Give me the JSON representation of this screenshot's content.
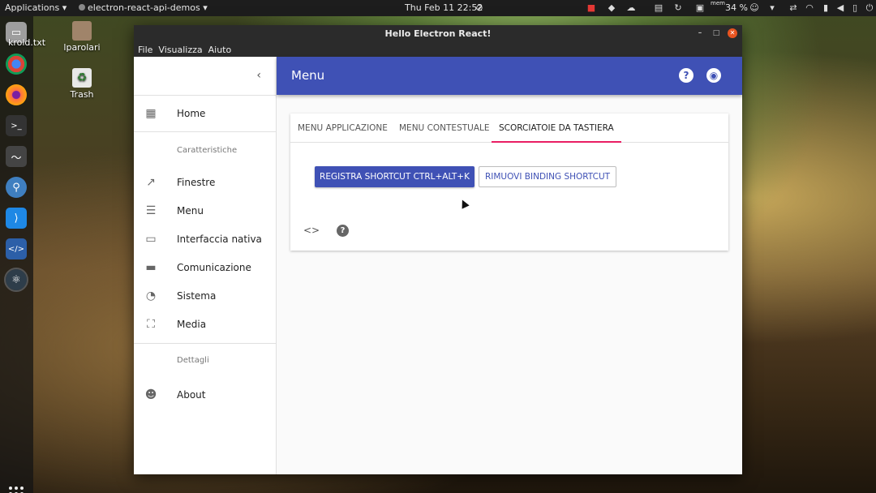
{
  "topbar": {
    "applications": "Applications ▾",
    "active_app": "electron-react-api-demos ▾",
    "clock": "Thu Feb 11  22:52",
    "mem_label": "mem",
    "mem_percent": "34 %"
  },
  "desktop": {
    "icons": [
      {
        "label": "krold.txt"
      },
      {
        "label": "lparolari"
      },
      {
        "label": "Trash"
      }
    ]
  },
  "window": {
    "title": "Hello Electron React!",
    "menu": [
      "File",
      "Visualizza",
      "Aiuto"
    ]
  },
  "sidebar": {
    "items": [
      {
        "label": "Home",
        "icon": "dashboard-icon"
      },
      {
        "section": "Caratteristiche"
      },
      {
        "label": "Finestre",
        "icon": "open-in-new-icon"
      },
      {
        "label": "Menu",
        "icon": "list-icon"
      },
      {
        "label": "Interfaccia nativa",
        "icon": "airplay-icon"
      },
      {
        "label": "Comunicazione",
        "icon": "chat-icon"
      },
      {
        "label": "Sistema",
        "icon": "speedometer-icon"
      },
      {
        "label": "Media",
        "icon": "photo-size-select-icon"
      },
      {
        "section": "Dettagli"
      },
      {
        "label": "About",
        "icon": "people-icon"
      }
    ]
  },
  "appbar": {
    "title": "Menu"
  },
  "tabs": [
    {
      "label": "MENU APPLICAZIONE"
    },
    {
      "label": "MENU CONTESTUALE"
    },
    {
      "label": "SCORCIATOIE DA TASTIERA",
      "active": true
    }
  ],
  "card": {
    "primary_button": "REGISTRA SHORTCUT CTRL+ALT+K",
    "secondary_button": "RIMUOVI BINDING SHORTCUT"
  },
  "colors": {
    "primary": "#3f51b5",
    "tab_indicator": "#e91e63",
    "close_button": "#e95420"
  }
}
